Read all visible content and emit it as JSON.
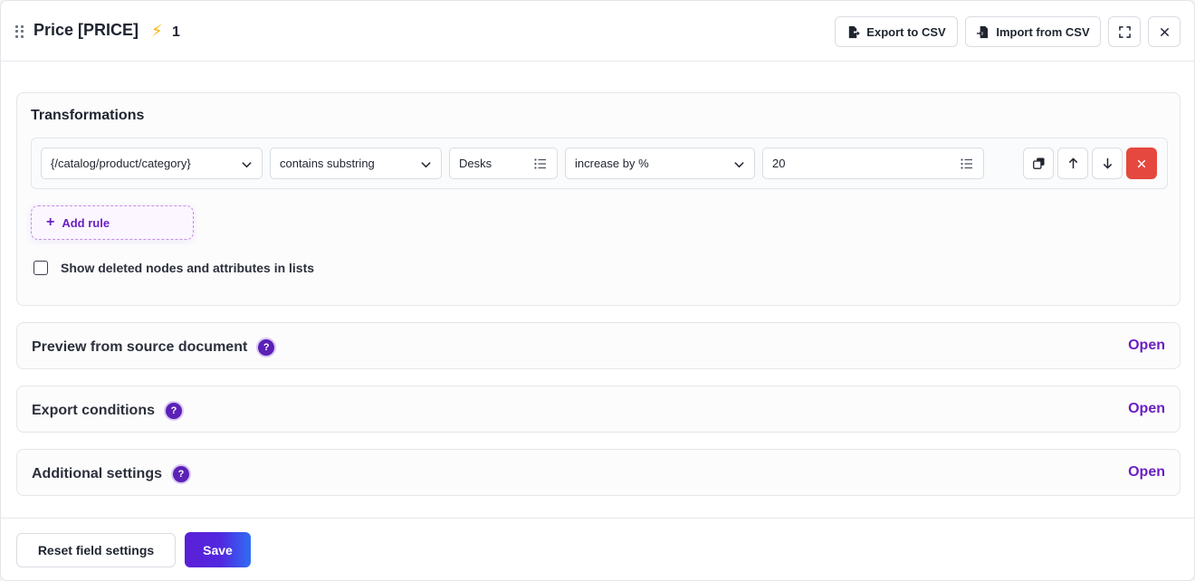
{
  "header": {
    "title": "Price [PRICE]",
    "bolt_icon": "lightning-icon",
    "count": "1",
    "export_label": "Export to CSV",
    "import_label": "Import from CSV"
  },
  "transformations": {
    "title": "Transformations",
    "rule": {
      "source": "{/catalog/product/category}",
      "condition": "contains substring",
      "match_value": "Desks",
      "action": "increase by %",
      "amount": "20"
    },
    "add_rule_label": "Add rule",
    "show_deleted_label": "Show deleted nodes and attributes in lists",
    "show_deleted_checked": false
  },
  "sections": [
    {
      "title": "Preview from source document",
      "action": "Open"
    },
    {
      "title": "Export conditions",
      "action": "Open"
    },
    {
      "title": "Additional settings",
      "action": "Open"
    }
  ],
  "footer": {
    "reset_label": "Reset field settings",
    "save_label": "Save"
  },
  "colors": {
    "accent": "#6a1fc2",
    "danger": "#e5483f",
    "bolt": "#f5b301"
  }
}
